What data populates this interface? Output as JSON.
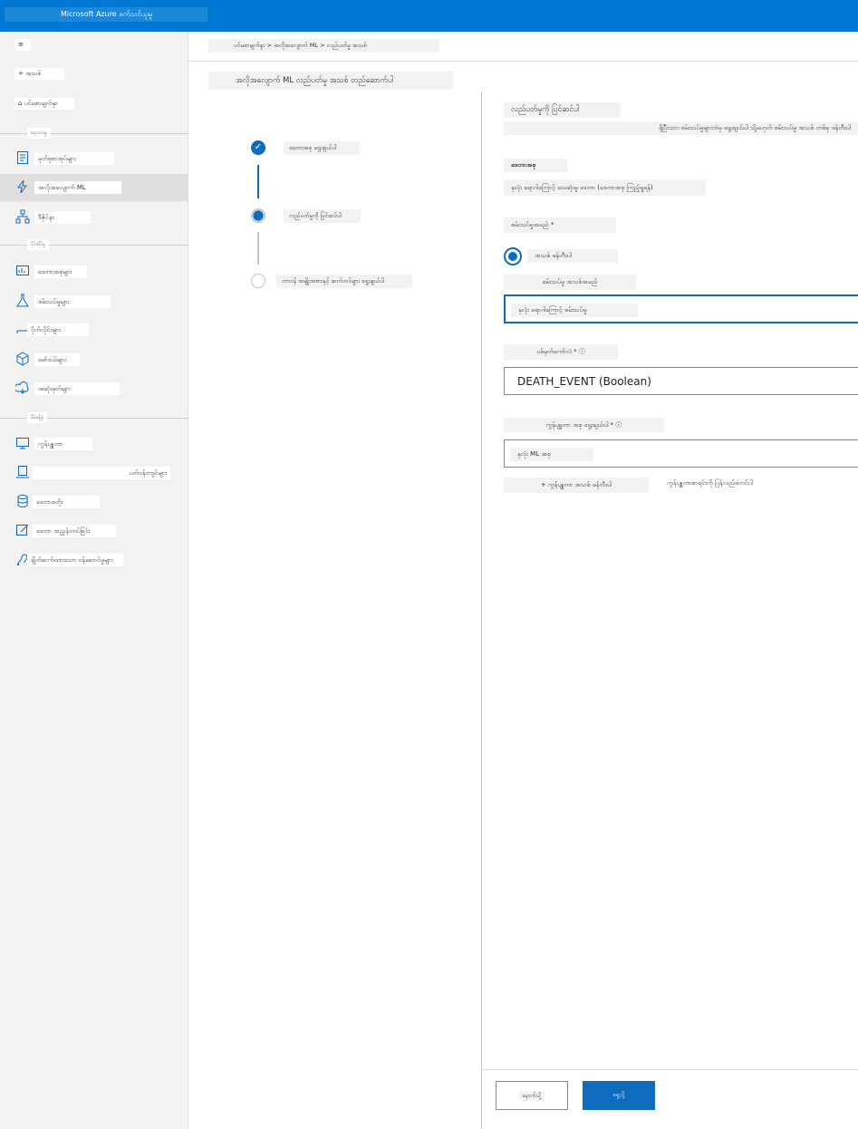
{
  "app": {
    "title": "Microsoft Azure စက်သင်ယူမှု"
  },
  "sidebar": {
    "top_items": [
      {
        "label": "≡"
      },
      {
        "label": "+ အသစ်"
      },
      {
        "label": "⌂ ပင်မစာမျက်နှာ"
      }
    ],
    "sections": {
      "author": "ရေးသားမှု",
      "assets": "ပိုင်ဆိုင်မှု",
      "manage": "စီမံခန့်ခွဲ"
    },
    "author_items": [
      {
        "label": "မှတ်စုစာအုပ်များ",
        "icon": "notebook-icon"
      },
      {
        "label": "အလိုအလျောက် ML",
        "icon": "automl-lightning-icon"
      },
      {
        "label": "ဒီဇိုင်နာ",
        "icon": "designer-hierarchy-icon"
      }
    ],
    "asset_items": [
      {
        "label": "ဒေတာအစုများ",
        "icon": "datasets-icon"
      },
      {
        "label": "စမ်းသပ်မှုများ",
        "icon": "experiments-flask-icon"
      },
      {
        "label": "ပိုက်လိုင်းများ",
        "icon": "pipelines-icon"
      },
      {
        "label": "မော်ဒယ်များ",
        "icon": "models-cube-icon"
      },
      {
        "label": "အဆုံးမှတ်များ",
        "icon": "endpoints-icon"
      }
    ],
    "manage_items": [
      {
        "label": "ကွန်ပျူတာ",
        "icon": "compute-monitor-icon"
      },
      {
        "label": "ပတ်ဝန်းကျင်များ",
        "icon": "environments-icon"
      },
      {
        "label": "ဒေတာစတိုး",
        "icon": "datastore-icon"
      },
      {
        "label": "ဒေတာ အညွှန်းတပ်ခြင်း",
        "icon": "labeling-edit-icon"
      },
      {
        "label": "ချိတ်ဆက်ထားသော ဝန်ဆောင်မှုများ",
        "icon": "linked-services-icon"
      }
    ]
  },
  "breadcrumb": "ပင်မစာမျက်နှာ > အလိုအလျောက် ML > လည်ပတ်မှု အသစ်",
  "page_title": "အလိုအလျောက် ML လည်ပတ်မှု အသစ် တည်ဆောက်ပါ",
  "steps": [
    {
      "label": "ဒေတာအစု ရွေးချယ်ပါ",
      "status": "done"
    },
    {
      "label": "လည်ပတ်မှုကို ပြင်ဆင်ပါ",
      "status": "current"
    },
    {
      "label": "တာဝန် အမျိုးအစားနှင့် ဆက်တင်များ ရွေးချယ်ပါ",
      "status": "pending"
    }
  ],
  "form": {
    "heading": "လည်ပတ်မှုကို ပြင်ဆင်ပါ",
    "description": "ရှိပြီးသား စမ်းသပ်မှုများထဲမှ ရွေးချယ်ပါ သို့မဟုတ် စမ်းသပ်မှု အသစ် တစ်ခု ဖန်တီးပါ",
    "dataset_label": "ဒေတာအစု",
    "dataset_value": "နှလုံး ရောဂါကြောင့် သေဆုံးမှု ဒေတာ (ဒေတာအစု ကြည့်ရှုရန်)",
    "experiment_label": "စမ်းသပ်မှုအမည် *",
    "radio_option": "အသစ် ဖန်တီးပါ",
    "new_experiment_label": "စမ်းသပ်မှု အသစ်အမည်",
    "experiment_value": "နှလုံး ရောဂါကြောင့် စမ်းသပ်မှု",
    "target_label": "ပစ်မှတ်ကော်လံ * ⓘ",
    "target_value": "DEATH_EVENT (Boolean)",
    "compute_label": "ကွန်ပျူတာ အစု ရွေးချယ်ပါ * ⓘ",
    "compute_value": "နှလုံး ML အစု",
    "create_compute": "+ ကွန်ပျူတာ အသစ် ဖန်တီးပါ",
    "refresh_compute": "ကွန်ပျူတာစာရင်းကို ပြန်လည်စတင်ပါ"
  },
  "buttons": {
    "back": "နောက်သို့",
    "next": "ရှေ့သို့"
  }
}
